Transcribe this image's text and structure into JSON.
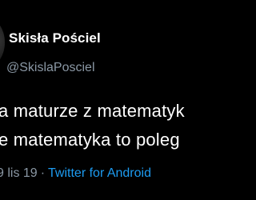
{
  "tweet": {
    "author": {
      "display_name": "Skisła Pościel",
      "handle": "@SkislaPosciel"
    },
    "text_lines": [
      "a maturze z matematyk",
      "e matematyka to poleg"
    ],
    "date": "9 lis 19",
    "separator": "·",
    "source": "Twitter for Android"
  },
  "colors": {
    "background": "#000000",
    "text": "#ffffff",
    "secondary": "#8b98a5",
    "link": "#1d9bf0"
  }
}
